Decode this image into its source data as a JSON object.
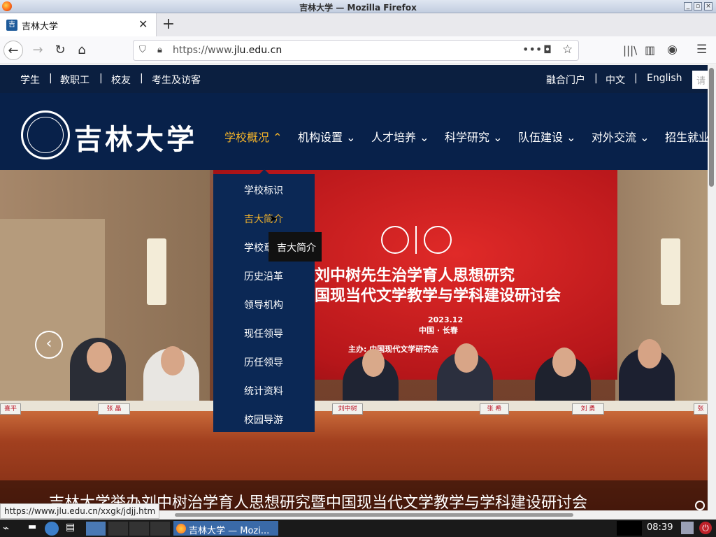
{
  "window": {
    "title": "吉林大学 — Mozilla Firefox"
  },
  "tab": {
    "title": "吉林大学",
    "favicon": "jlu-favicon"
  },
  "navbar": {
    "url_prefix": "https://www.",
    "url_domain": "jlu.edu.cn"
  },
  "site": {
    "topbar": {
      "left": [
        "学生",
        "|",
        "教职工",
        "|",
        "校友",
        "|",
        "考生及访客"
      ],
      "right": [
        "融合门户",
        "|",
        "中文",
        "|",
        "English"
      ],
      "search_placeholder": "请"
    },
    "logo_text": "吉林大学",
    "menu": [
      {
        "label": "学校概况",
        "active": true
      },
      {
        "label": "机构设置",
        "active": false
      },
      {
        "label": "人才培养",
        "active": false
      },
      {
        "label": "科学研究",
        "active": false
      },
      {
        "label": "队伍建设",
        "active": false
      },
      {
        "label": "对外交流",
        "active": false
      },
      {
        "label": "招生就业",
        "active": false
      }
    ],
    "dropdown": [
      "学校标识",
      "吉大简介",
      "学校章",
      "历史沿革",
      "领导机构",
      "现任领导",
      "历任领导",
      "统计资料",
      "校园导游"
    ],
    "dropdown_hover_index": 1,
    "tooltip": "吉大简介",
    "hero": {
      "banner_line1": "刘中树先生治学育人思想研究",
      "banner_line2": "国现当代文学教学与学科建设研讨会",
      "banner_date": "2023.12",
      "banner_place": "中国 · 长春",
      "banner_host": "主办: 中国现代文学研究会",
      "nameplates": [
        "喜平",
        "张 晶",
        "刘中树",
        "张 希",
        "刘 勇",
        "张"
      ],
      "caption": "吉林大学举办刘中树治学育人思想研究暨中国现当代文学教学与学科建设研讨会"
    }
  },
  "status_url": "https://www.jlu.edu.cn/xxgk/jdjj.htm",
  "taskbar": {
    "task_label": "吉林大学 — Mozi...",
    "clock": "08:39"
  },
  "colors": {
    "nav_bg": "#08214a",
    "accent": "#f3b32a",
    "banner_red": "#c8181c"
  }
}
